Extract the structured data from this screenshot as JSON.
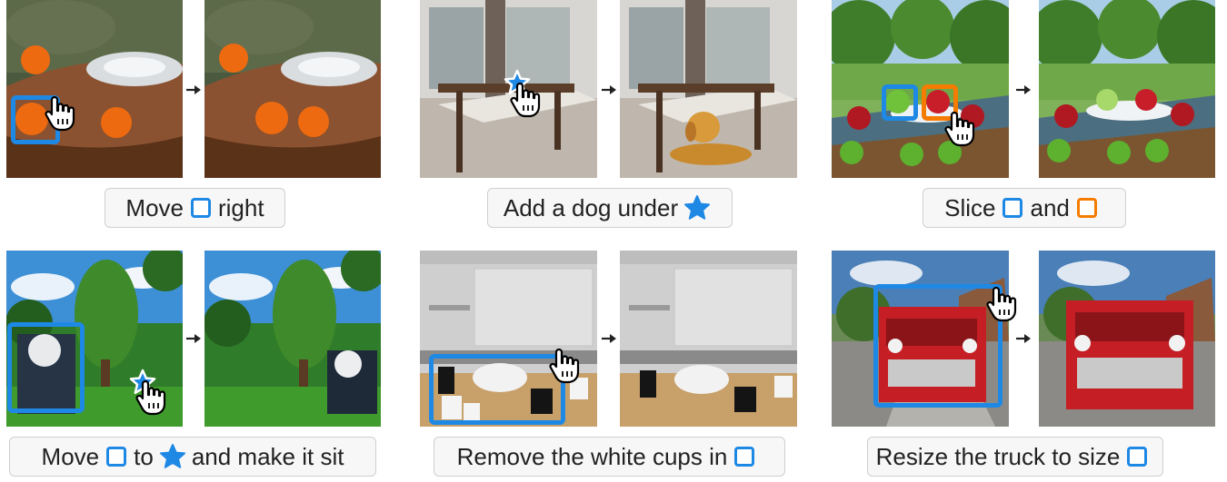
{
  "colors": {
    "box_blue": "#1e88e5",
    "box_orange": "#f57c00",
    "star": "#1e88e5"
  },
  "icons": [
    "pointer-hand-icon",
    "star-icon",
    "arrow-right-icon",
    "square-box-icon"
  ],
  "panels": [
    {
      "caption_parts": [
        "Move",
        "right"
      ]
    },
    {
      "caption_parts": [
        "Add a dog under"
      ]
    },
    {
      "caption_parts": [
        "Slice",
        "and"
      ]
    },
    {
      "caption_parts": [
        "Move",
        "to",
        "and make it sit"
      ]
    },
    {
      "caption_parts": [
        "Remove the white cups in"
      ]
    },
    {
      "caption_parts": [
        "Resize the truck to size"
      ]
    }
  ]
}
